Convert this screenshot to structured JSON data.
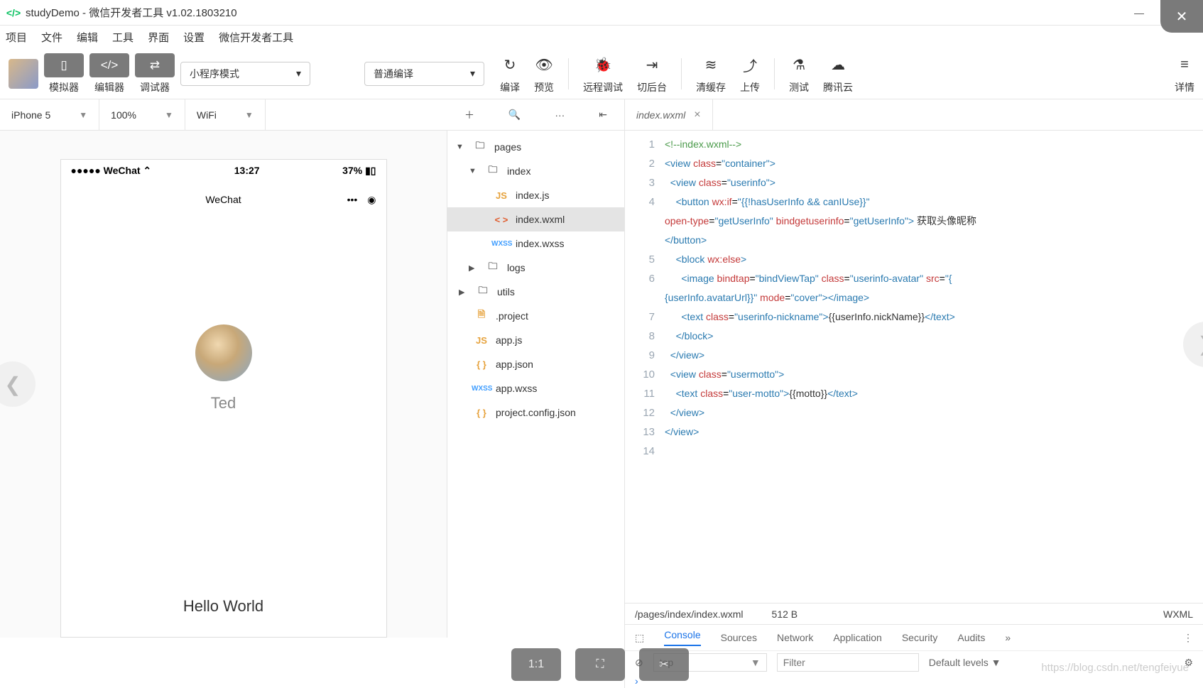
{
  "window": {
    "title": "studyDemo - 微信开发者工具 v1.02.1803210"
  },
  "menu": [
    "项目",
    "文件",
    "编辑",
    "工具",
    "界面",
    "设置",
    "微信开发者工具"
  ],
  "toolbar": {
    "simulator": "模拟器",
    "editor": "编辑器",
    "debugger": "调试器",
    "modeSelect": "小程序模式",
    "compileSelect": "普通编译",
    "compile": "编译",
    "preview": "预览",
    "remote": "远程调试",
    "background": "切后台",
    "clearCache": "清缓存",
    "upload": "上传",
    "test": "测试",
    "cloud": "腾讯云",
    "detail": "详情"
  },
  "simbar": {
    "device": "iPhone 5",
    "zoom": "100%",
    "network": "WiFi"
  },
  "phone": {
    "carrier": "WeChat",
    "time": "13:27",
    "battery": "37%",
    "navTitle": "WeChat",
    "username": "Ted",
    "motto": "Hello World"
  },
  "tree": {
    "pages": "pages",
    "index": "index",
    "index_js": "index.js",
    "index_wxml": "index.wxml",
    "index_wxss": "index.wxss",
    "logs": "logs",
    "utils": "utils",
    "project": ".project",
    "app_js": "app.js",
    "app_json": "app.json",
    "app_wxss": "app.wxss",
    "config": "project.config.json"
  },
  "editor": {
    "tab": "index.wxml",
    "path": "/pages/index/index.wxml",
    "size": "512 B",
    "lang": "WXML",
    "buttonText": "获取头像昵称"
  },
  "devtools": {
    "tabs": [
      "Console",
      "Sources",
      "Network",
      "Application",
      "Security",
      "Audits"
    ],
    "ctx": "top",
    "filter_ph": "Filter",
    "levels": "Default levels ▼"
  },
  "float": {
    "ratio": "1:1"
  },
  "watermark": "https://blog.csdn.net/tengfeiyue"
}
